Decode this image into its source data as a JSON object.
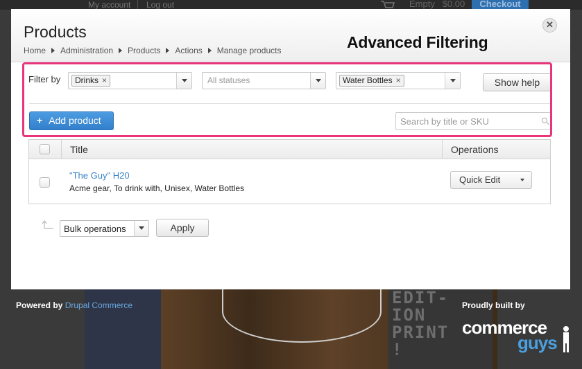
{
  "top_bar": {
    "my_account": "My account",
    "log_out": "Log out",
    "cart_status": "Empty",
    "cart_total": "$0.00",
    "checkout": "Checkout"
  },
  "modal": {
    "title": "Products",
    "breadcrumb": [
      "Home",
      "Administration",
      "Products",
      "Actions",
      "Manage products"
    ],
    "close_symbol": "✕"
  },
  "annotation": {
    "label": "Advanced Filtering",
    "color": "#e9337a"
  },
  "filters": {
    "label": "Filter by",
    "category_chip": "Drinks",
    "status_placeholder": "All statuses",
    "type_chip": "Water Bottles",
    "chip_remove_symbol": "×",
    "show_help": "Show help"
  },
  "actions": {
    "add_product_icon": "+",
    "add_product": "Add product",
    "search_placeholder": "Search by title or SKU"
  },
  "table": {
    "columns": [
      "Title",
      "Operations"
    ],
    "rows": [
      {
        "title": "\"The Guy\" H20",
        "tags": "Acme gear, To drink with, Unisex, Water Bottles",
        "operation": "Quick Edit"
      }
    ]
  },
  "bulk": {
    "select_value": "Bulk operations",
    "apply": "Apply"
  },
  "footer": {
    "powered_by": "Powered by",
    "powered_by_link": "Drupal Commerce",
    "proudly_built_by": "Proudly built by",
    "logo_word1": "commerce",
    "logo_word2": "guys"
  },
  "background": {
    "poster_text": "EDIT-\nION\nPRINT\n!"
  },
  "colors": {
    "accent_blue": "#3a8ad6",
    "link_blue": "#3b84c9",
    "highlight_pink": "#e9337a"
  }
}
